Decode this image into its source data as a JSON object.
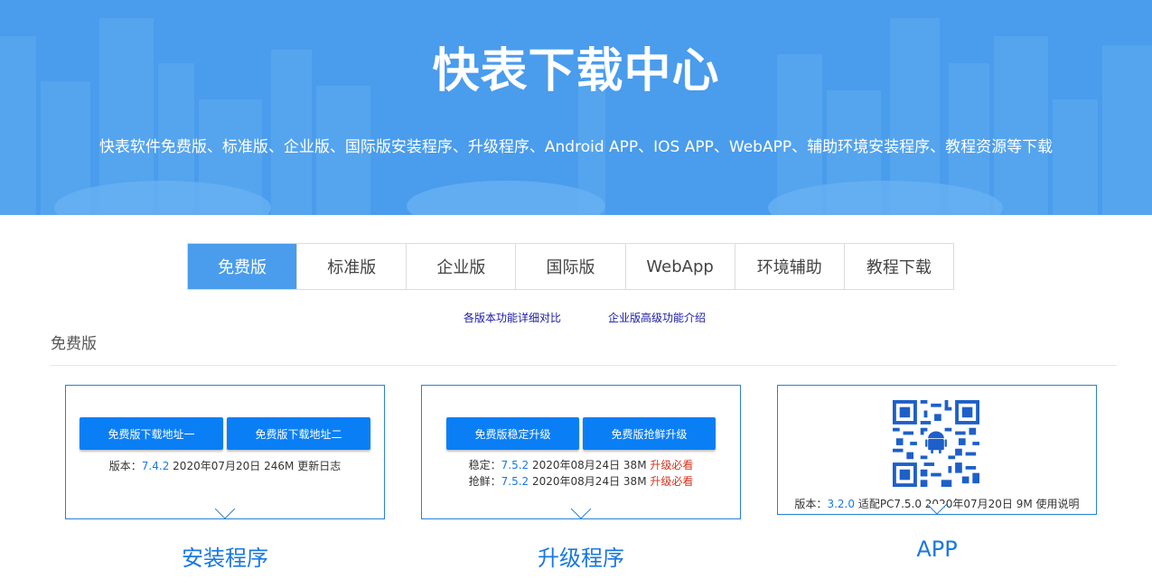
{
  "hero": {
    "title": "快表下载中心",
    "subtitle": "快表软件免费版、标准版、企业版、国际版安装程序、升级程序、Android APP、IOS APP、WebAPP、辅助环境安装程序、教程资源等下载"
  },
  "tabs": [
    {
      "label": "免费版",
      "active": true
    },
    {
      "label": "标准版"
    },
    {
      "label": "企业版"
    },
    {
      "label": "国际版"
    },
    {
      "label": "WebApp"
    },
    {
      "label": "环境辅助"
    },
    {
      "label": "教程下载"
    }
  ],
  "links": {
    "compare": "各版本功能详细对比",
    "enterprise": "企业版高级功能介绍"
  },
  "section_title": "免费版",
  "install": {
    "btn1": "免费版下载地址一",
    "btn2": "免费版下载地址二",
    "version_label": "版本：",
    "version": "7.4.2",
    "date": "2020年07月20日",
    "size": "246M",
    "log": "更新日志",
    "label": "安装程序"
  },
  "upgrade": {
    "btn1": "免费版稳定升级",
    "btn2": "免费版抢鲜升级",
    "stable_label": "稳定：",
    "stable_version": "7.5.2",
    "stable_date": "2020年08月24日",
    "stable_size": "38M",
    "stable_note": "升级必看",
    "beta_label": "抢鲜：",
    "beta_version": "7.5.2",
    "beta_date": "2020年08月24日",
    "beta_size": "38M",
    "beta_note": "升级必看",
    "label": "升级程序"
  },
  "app": {
    "version_label": "版本：",
    "version": "3.2.0",
    "compat": "适配PC7.5.0",
    "date": "2020年07月20日",
    "size": "9M",
    "guide": "使用说明",
    "label": "APP",
    "qr_icon": "android-icon"
  },
  "colors": {
    "hero_bg": "#4a9cec",
    "accent": "#0a7ff5",
    "link_blue": "#1a78e0",
    "warn_red": "#d9321c"
  }
}
